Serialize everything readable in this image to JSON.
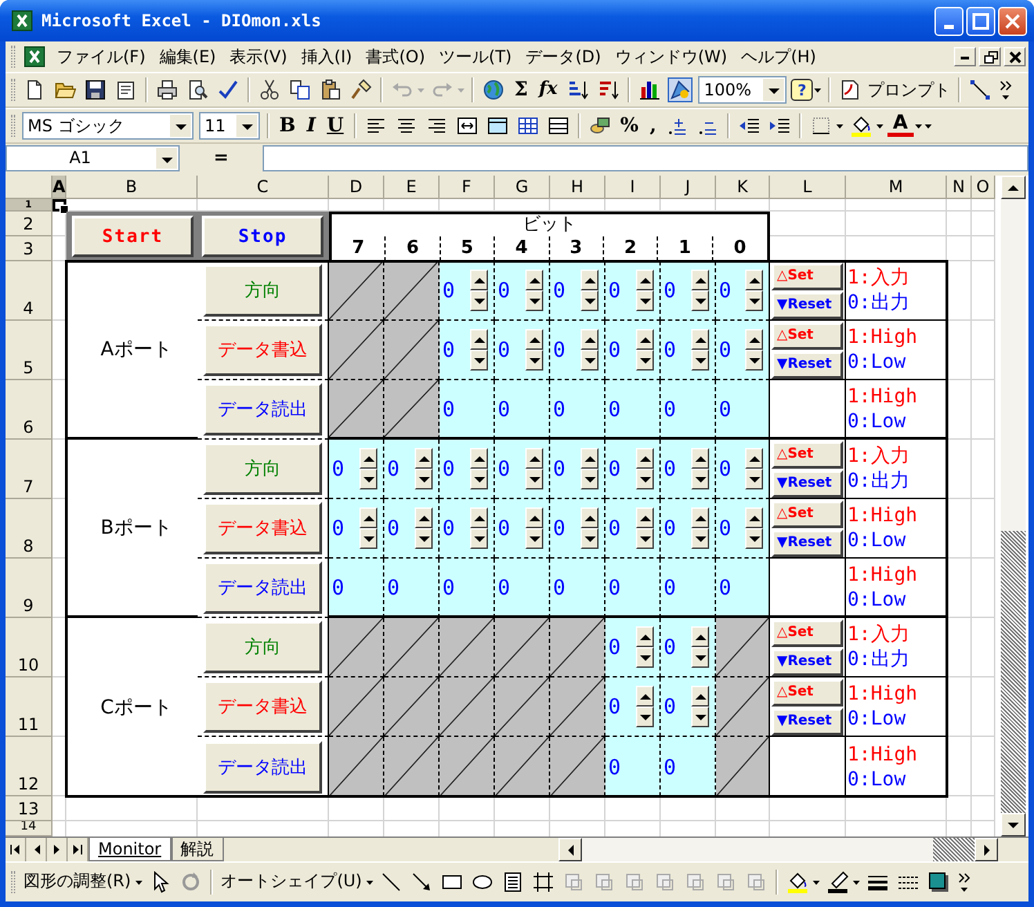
{
  "window": {
    "title": "Microsoft Excel - DIOmon.xls"
  },
  "menu": [
    "ファイル(F)",
    "編集(E)",
    "表示(V)",
    "挿入(I)",
    "書式(O)",
    "ツール(T)",
    "データ(D)",
    "ウィンドウ(W)",
    "ヘルプ(H)"
  ],
  "standard_toolbar": {
    "sum": "Σ",
    "function": "fx",
    "zoom": "100%",
    "help": "?",
    "prompt": "プロンプト"
  },
  "formatting_toolbar": {
    "font": "MS ゴシック",
    "size": "11",
    "bold": "B",
    "italic": "I",
    "underline": "U",
    "percent": "%",
    "comma": ",",
    "font_color": "A"
  },
  "formula_bar": {
    "name_box": "A1",
    "equals": "="
  },
  "columns": [
    {
      "label": "A",
      "selected": true
    },
    {
      "label": "B",
      "selected": false
    },
    {
      "label": "C",
      "selected": false
    },
    {
      "label": "D",
      "selected": false
    },
    {
      "label": "E",
      "selected": false
    },
    {
      "label": "F",
      "selected": false
    },
    {
      "label": "G",
      "selected": false
    },
    {
      "label": "H",
      "selected": false
    },
    {
      "label": "I",
      "selected": false
    },
    {
      "label": "J",
      "selected": false
    },
    {
      "label": "K",
      "selected": false
    },
    {
      "label": "L",
      "selected": false
    },
    {
      "label": "M",
      "selected": false
    },
    {
      "label": "N",
      "selected": false
    },
    {
      "label": "O",
      "selected": false
    }
  ],
  "rows": [
    {
      "label": "1",
      "selected": true
    },
    {
      "label": "2",
      "selected": false
    },
    {
      "label": "3",
      "selected": false
    },
    {
      "label": "4",
      "selected": false
    },
    {
      "label": "5",
      "selected": false
    },
    {
      "label": "6",
      "selected": false
    },
    {
      "label": "7",
      "selected": false
    },
    {
      "label": "8",
      "selected": false
    },
    {
      "label": "9",
      "selected": false
    },
    {
      "label": "10",
      "selected": false
    },
    {
      "label": "11",
      "selected": false
    },
    {
      "label": "12",
      "selected": false
    },
    {
      "label": "13",
      "selected": false
    },
    {
      "label": "14",
      "selected": false
    }
  ],
  "sheet": {
    "controls": [
      {
        "label": "Start",
        "color": "#ff0000"
      },
      {
        "label": "Stop",
        "color": "#0000ff"
      }
    ],
    "bit_header": "ビット",
    "bits": [
      "7",
      "6",
      "5",
      "4",
      "3",
      "2",
      "1",
      "0"
    ],
    "ports": [
      {
        "label": "Aポート",
        "rows": [
          {
            "button": {
              "label": "方向",
              "color": "#008000"
            },
            "cells": [
              {
                "kind": "blocked"
              },
              {
                "kind": "blocked"
              },
              {
                "kind": "spin",
                "value": "0"
              },
              {
                "kind": "spin",
                "value": "0"
              },
              {
                "kind": "spin",
                "value": "0"
              },
              {
                "kind": "spin",
                "value": "0"
              },
              {
                "kind": "spin",
                "value": "0"
              },
              {
                "kind": "spin",
                "value": "0"
              }
            ],
            "set": "△Set",
            "reset": "▼Reset",
            "legend": [
              {
                "text": "1:入力",
                "color": "#ff0000"
              },
              {
                "text": "0:出力",
                "color": "#0000ff"
              }
            ]
          },
          {
            "button": {
              "label": "データ書込",
              "color": "#ff0000"
            },
            "cells": [
              {
                "kind": "blocked"
              },
              {
                "kind": "blocked"
              },
              {
                "kind": "spin",
                "value": "0"
              },
              {
                "kind": "spin",
                "value": "0"
              },
              {
                "kind": "spin",
                "value": "0"
              },
              {
                "kind": "spin",
                "value": "0"
              },
              {
                "kind": "spin",
                "value": "0"
              },
              {
                "kind": "spin",
                "value": "0"
              }
            ],
            "set": "△Set",
            "reset": "▼Reset",
            "legend": [
              {
                "text": "1:High",
                "color": "#ff0000"
              },
              {
                "text": "0:Low",
                "color": "#0000ff"
              }
            ]
          },
          {
            "button": {
              "label": "データ読出",
              "color": "#0000ff"
            },
            "cells": [
              {
                "kind": "blocked"
              },
              {
                "kind": "blocked"
              },
              {
                "kind": "read",
                "value": "0"
              },
              {
                "kind": "read",
                "value": "0"
              },
              {
                "kind": "read",
                "value": "0"
              },
              {
                "kind": "read",
                "value": "0"
              },
              {
                "kind": "read",
                "value": "0"
              },
              {
                "kind": "read",
                "value": "0"
              }
            ],
            "legend": [
              {
                "text": "1:High",
                "color": "#ff0000"
              },
              {
                "text": "0:Low",
                "color": "#0000ff"
              }
            ]
          }
        ]
      },
      {
        "label": "Bポート",
        "rows": [
          {
            "button": {
              "label": "方向",
              "color": "#008000"
            },
            "cells": [
              {
                "kind": "spin",
                "value": "0"
              },
              {
                "kind": "spin",
                "value": "0"
              },
              {
                "kind": "spin",
                "value": "0"
              },
              {
                "kind": "spin",
                "value": "0"
              },
              {
                "kind": "spin",
                "value": "0"
              },
              {
                "kind": "spin",
                "value": "0"
              },
              {
                "kind": "spin",
                "value": "0"
              },
              {
                "kind": "spin",
                "value": "0"
              }
            ],
            "set": "△Set",
            "reset": "▼Reset",
            "legend": [
              {
                "text": "1:入力",
                "color": "#ff0000"
              },
              {
                "text": "0:出力",
                "color": "#0000ff"
              }
            ]
          },
          {
            "button": {
              "label": "データ書込",
              "color": "#ff0000"
            },
            "cells": [
              {
                "kind": "spin",
                "value": "0"
              },
              {
                "kind": "spin",
                "value": "0"
              },
              {
                "kind": "spin",
                "value": "0"
              },
              {
                "kind": "spin",
                "value": "0"
              },
              {
                "kind": "spin",
                "value": "0"
              },
              {
                "kind": "spin",
                "value": "0"
              },
              {
                "kind": "spin",
                "value": "0"
              },
              {
                "kind": "spin",
                "value": "0"
              }
            ],
            "set": "△Set",
            "reset": "▼Reset",
            "legend": [
              {
                "text": "1:High",
                "color": "#ff0000"
              },
              {
                "text": "0:Low",
                "color": "#0000ff"
              }
            ]
          },
          {
            "button": {
              "label": "データ読出",
              "color": "#0000ff"
            },
            "cells": [
              {
                "kind": "read",
                "value": "0"
              },
              {
                "kind": "read",
                "value": "0"
              },
              {
                "kind": "read",
                "value": "0"
              },
              {
                "kind": "read",
                "value": "0"
              },
              {
                "kind": "read",
                "value": "0"
              },
              {
                "kind": "read",
                "value": "0"
              },
              {
                "kind": "read",
                "value": "0"
              },
              {
                "kind": "read",
                "value": "0"
              }
            ],
            "legend": [
              {
                "text": "1:High",
                "color": "#ff0000"
              },
              {
                "text": "0:Low",
                "color": "#0000ff"
              }
            ]
          }
        ]
      },
      {
        "label": "Cポート",
        "rows": [
          {
            "button": {
              "label": "方向",
              "color": "#008000"
            },
            "cells": [
              {
                "kind": "blocked"
              },
              {
                "kind": "blocked"
              },
              {
                "kind": "blocked"
              },
              {
                "kind": "blocked"
              },
              {
                "kind": "blocked"
              },
              {
                "kind": "spin",
                "value": "0"
              },
              {
                "kind": "spin",
                "value": "0"
              },
              {
                "kind": "blocked"
              }
            ],
            "set": "△Set",
            "reset": "▼Reset",
            "legend": [
              {
                "text": "1:入力",
                "color": "#ff0000"
              },
              {
                "text": "0:出力",
                "color": "#0000ff"
              }
            ]
          },
          {
            "button": {
              "label": "データ書込",
              "color": "#ff0000"
            },
            "cells": [
              {
                "kind": "blocked"
              },
              {
                "kind": "blocked"
              },
              {
                "kind": "blocked"
              },
              {
                "kind": "blocked"
              },
              {
                "kind": "blocked"
              },
              {
                "kind": "spin",
                "value": "0"
              },
              {
                "kind": "spin",
                "value": "0"
              },
              {
                "kind": "blocked"
              }
            ],
            "set": "△Set",
            "reset": "▼Reset",
            "legend": [
              {
                "text": "1:High",
                "color": "#ff0000"
              },
              {
                "text": "0:Low",
                "color": "#0000ff"
              }
            ]
          },
          {
            "button": {
              "label": "データ読出",
              "color": "#0000ff"
            },
            "cells": [
              {
                "kind": "blocked"
              },
              {
                "kind": "blocked"
              },
              {
                "kind": "blocked"
              },
              {
                "kind": "blocked"
              },
              {
                "kind": "blocked"
              },
              {
                "kind": "read",
                "value": "0"
              },
              {
                "kind": "read",
                "value": "0"
              },
              {
                "kind": "blocked"
              }
            ],
            "legend": [
              {
                "text": "1:High",
                "color": "#ff0000"
              },
              {
                "text": "0:Low",
                "color": "#0000ff"
              }
            ]
          }
        ]
      }
    ]
  },
  "sheet_tabs": [
    {
      "label": "Monitor",
      "selected": true
    },
    {
      "label": "解説",
      "selected": false
    }
  ],
  "drawing_toolbar": {
    "arrange": "図形の調整(R)",
    "autoshapes": "オートシェイプ(U)"
  }
}
